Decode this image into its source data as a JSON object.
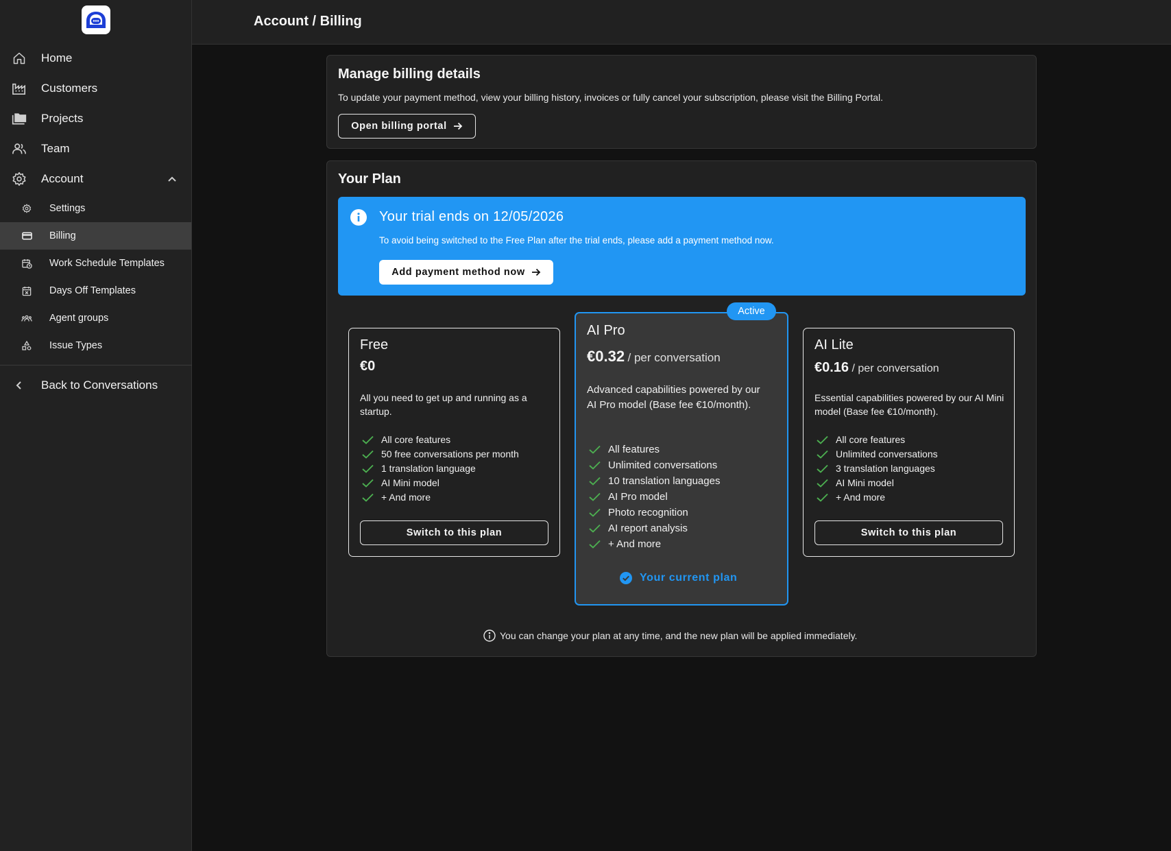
{
  "header": {
    "title": "Account / Billing"
  },
  "sidebar": {
    "items": [
      {
        "label": "Home",
        "icon": "home-icon"
      },
      {
        "label": "Customers",
        "icon": "factory-icon"
      },
      {
        "label": "Projects",
        "icon": "folder-icon"
      },
      {
        "label": "Team",
        "icon": "users-icon"
      },
      {
        "label": "Account",
        "icon": "gear-icon"
      }
    ],
    "sub_items": [
      {
        "label": "Settings",
        "icon": "gear-icon"
      },
      {
        "label": "Billing",
        "icon": "credit-card-icon",
        "active": true
      },
      {
        "label": "Work Schedule Templates",
        "icon": "calendar-clock-icon"
      },
      {
        "label": "Days Off Templates",
        "icon": "calendar-x-icon"
      },
      {
        "label": "Agent groups",
        "icon": "group-icon"
      },
      {
        "label": "Issue Types",
        "icon": "shapes-icon"
      }
    ],
    "back_label": "Back to Conversations"
  },
  "billing": {
    "title": "Manage billing details",
    "description": "To update your payment method, view your billing history, invoices or fully cancel your subscription, please visit the Billing Portal.",
    "button_label": "Open billing portal"
  },
  "plan_section": {
    "title": "Your Plan",
    "trial": {
      "title": "Your trial ends on 12/05/2026",
      "text": "To avoid being switched to the Free Plan after the trial ends, please add a payment method now.",
      "button_label": "Add payment method now"
    },
    "plans": [
      {
        "name": "Free",
        "price": "€0",
        "per": "",
        "description": "All you need to get up and running as a startup.",
        "features": [
          "All core features",
          "50 free conversations per month",
          "1 translation language",
          "AI Mini model",
          "+ And more"
        ],
        "button_label": "Switch to this plan"
      },
      {
        "name": "AI Pro",
        "price": "€0.32",
        "per": "/ per conversation",
        "badge": "Active",
        "description": "Advanced capabilities powered by our AI Pro model (Base fee €10/month).",
        "features": [
          "All features",
          "Unlimited conversations",
          "10 translation languages",
          "AI Pro model",
          "Photo recognition",
          "AI report analysis",
          "+ And more"
        ],
        "current_label": "Your current plan"
      },
      {
        "name": "AI Lite",
        "price": "€0.16",
        "per": "/ per conversation",
        "description": "Essential capabilities powered by our AI Mini model (Base fee €10/month).",
        "features": [
          "All core features",
          "Unlimited conversations",
          "3 translation languages",
          "AI Mini model",
          "+ And more"
        ],
        "button_label": "Switch to this plan"
      }
    ],
    "footnote": "You can change your plan at any time, and the new plan will be applied immediately."
  },
  "colors": {
    "accent": "#2196f3",
    "check": "#4caf50",
    "background": "#121212",
    "panel": "#212121"
  }
}
